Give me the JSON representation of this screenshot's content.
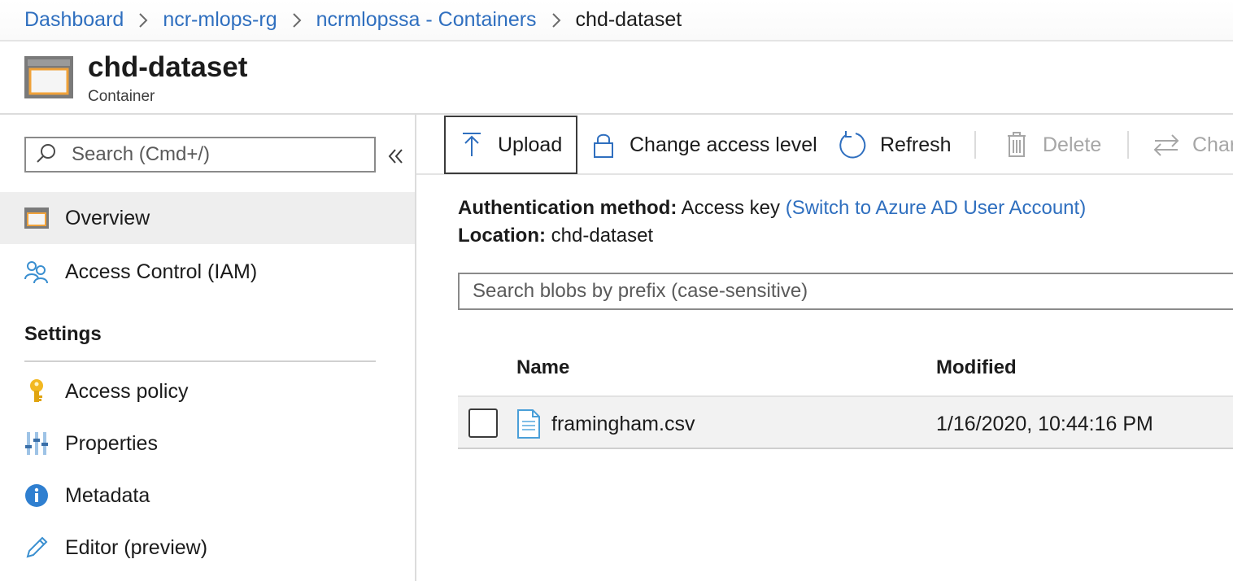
{
  "breadcrumb": {
    "items": [
      "Dashboard",
      "ncr-mlops-rg",
      "ncrmlopssa - Containers"
    ],
    "current": "chd-dataset"
  },
  "header": {
    "title": "chd-dataset",
    "subtitle": "Container",
    "icon": "container-icon"
  },
  "sidebar": {
    "search_placeholder": "Search (Cmd+/)",
    "items": [
      {
        "label": "Overview",
        "icon": "overview-icon",
        "active": true
      },
      {
        "label": "Access Control (IAM)",
        "icon": "people-icon"
      }
    ],
    "settings_title": "Settings",
    "settings_items": [
      {
        "label": "Access policy",
        "icon": "key-icon"
      },
      {
        "label": "Properties",
        "icon": "properties-icon"
      },
      {
        "label": "Metadata",
        "icon": "info-icon"
      },
      {
        "label": "Editor (preview)",
        "icon": "pencil-icon"
      }
    ]
  },
  "toolbar": {
    "upload": "Upload",
    "change_access": "Change access level",
    "refresh": "Refresh",
    "delete": "Delete",
    "change_tier": "Char"
  },
  "info": {
    "auth_label": "Authentication method:",
    "auth_value": "Access key",
    "auth_link": "(Switch to Azure AD User Account)",
    "location_label": "Location:",
    "location_value": "chd-dataset"
  },
  "blob_search": {
    "placeholder": "Search blobs by prefix (case-sensitive)"
  },
  "table": {
    "columns": [
      "Name",
      "Modified"
    ],
    "rows": [
      {
        "name": "framingham.csv",
        "modified": "1/16/2020, 10:44:16 PM",
        "icon": "file-icon"
      }
    ]
  },
  "colors": {
    "link": "#2f6fbf",
    "accent_orange": "#f0a23a",
    "icon_blue": "#2f6fbf",
    "disabled": "#a6a6a6"
  }
}
